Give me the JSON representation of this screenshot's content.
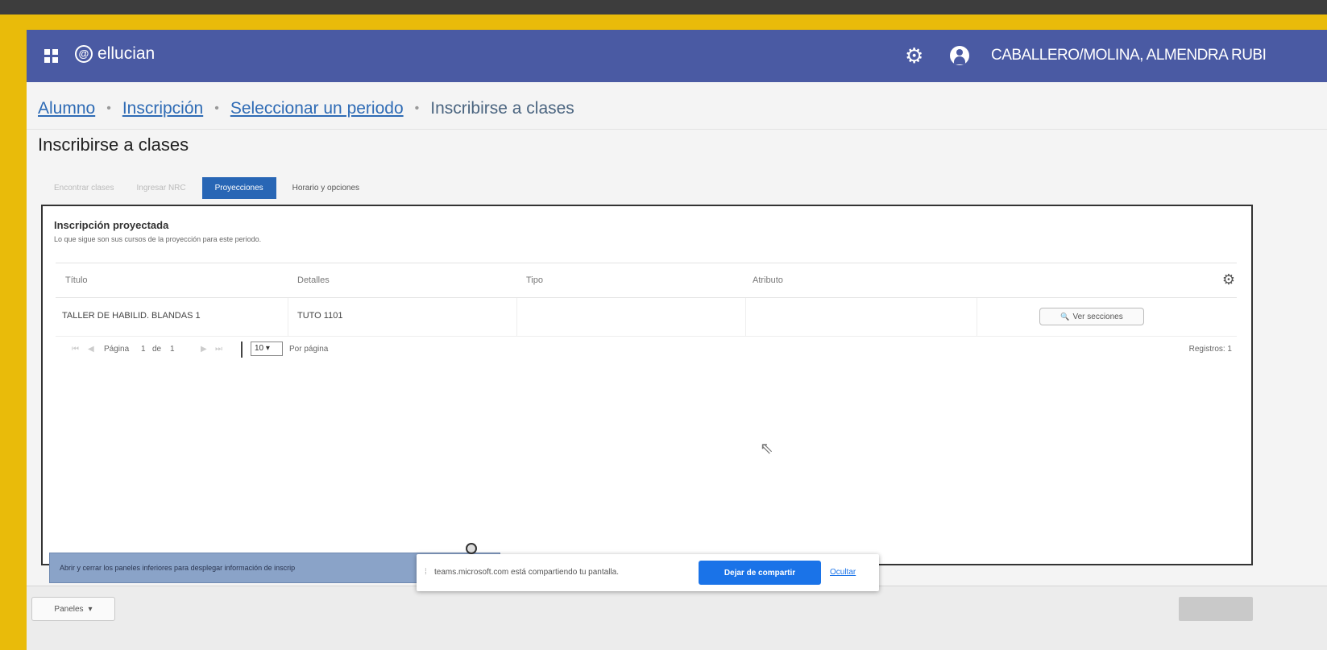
{
  "window": {
    "brand": "ellucian",
    "logo_mark": "@",
    "user_name": "CABALLERO/MOLINA, ALMENDRA RUBI"
  },
  "breadcrumb": {
    "items": [
      "Alumno",
      "Inscripción",
      "Seleccionar un periodo"
    ],
    "current": "Inscribirse a clases",
    "separator": "•"
  },
  "page": {
    "title": "Inscribirse a clases"
  },
  "tabs": [
    {
      "label": "Encontrar clases",
      "state": "disabled"
    },
    {
      "label": "Ingresar NRC",
      "state": "disabled"
    },
    {
      "label": "Proyecciones",
      "state": "active"
    },
    {
      "label": "Horario y opciones",
      "state": "normal"
    }
  ],
  "panel": {
    "title": "Inscripción proyectada",
    "subtitle": "Lo que sigue son sus cursos de la proyección para este periodo."
  },
  "table": {
    "headers": [
      "Título",
      "Detalles",
      "Tipo",
      "Atributo"
    ],
    "rows": [
      {
        "titulo": "TALLER DE HABILID. BLANDAS 1",
        "detalles": "TUTO 1101",
        "tipo": "",
        "atributo": "",
        "action": "Ver secciones"
      }
    ]
  },
  "pager": {
    "first": "⏮",
    "prev": "◀",
    "page_label": "Página",
    "page": "1",
    "of_label": "de",
    "total_pages": "1",
    "next": "▶",
    "last": "⏭",
    "per_page_value": "10",
    "per_page_label": "Por página",
    "records": "Registros: 1"
  },
  "hint": {
    "text": "Abrir y cerrar los paneles inferiores para desplegar información de inscrip"
  },
  "footer": {
    "paneles_label": "Paneles",
    "caret": "▾"
  },
  "share_banner": {
    "text": "teams.microsoft.com está compartiendo tu pantalla.",
    "stop_label": "Dejar de compartir",
    "hide_label": "Ocultar"
  },
  "icons": {
    "grid": "grid-icon",
    "gear": "⚙",
    "search": "🔍",
    "cursor": "⇖",
    "share": "⁞"
  },
  "colors": {
    "topbar": "#4a5aa3",
    "accent": "#2866b5",
    "share_frame": "#e9bb0a",
    "stop_button": "#1a73e8"
  }
}
